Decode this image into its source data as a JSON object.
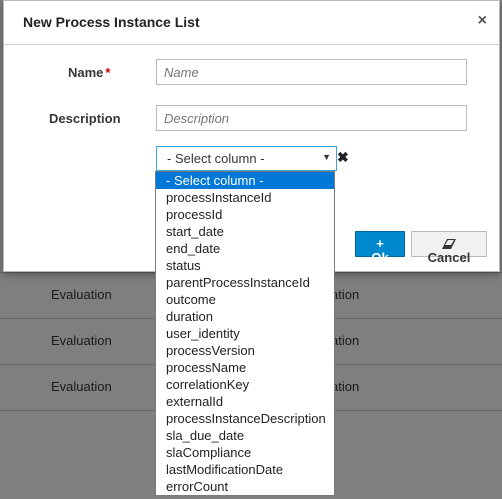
{
  "background": {
    "rows": [
      {
        "col1": "Evaluation",
        "col2": "ation"
      },
      {
        "col1": "Evaluation",
        "col2": "ation"
      },
      {
        "col1": "Evaluation",
        "col2": "ation"
      }
    ]
  },
  "modal": {
    "title": "New Process Instance List",
    "close_glyph": "×",
    "name_label": "Name",
    "required_marker": "*",
    "name_placeholder": "Name",
    "description_label": "Description",
    "description_placeholder": "Description",
    "select_value": "- Select column -",
    "select_arrow": "▼",
    "remove_glyph": "✖",
    "ok_label": "Ok",
    "ok_icon": "+",
    "cancel_label": "Cancel",
    "cancel_icon": "eraser-icon"
  },
  "dropdown": {
    "options": [
      "- Select column -",
      "processInstanceId",
      "processId",
      "start_date",
      "end_date",
      "status",
      "parentProcessInstanceId",
      "outcome",
      "duration",
      "user_identity",
      "processVersion",
      "processName",
      "correlationKey",
      "externalId",
      "processInstanceDescription",
      "sla_due_date",
      "slaCompliance",
      "lastModificationDate",
      "errorCount"
    ],
    "selected_index": 0
  },
  "colors": {
    "primary": "#0088ce",
    "selected_option": "#0078d7",
    "required": "#cc0000"
  }
}
